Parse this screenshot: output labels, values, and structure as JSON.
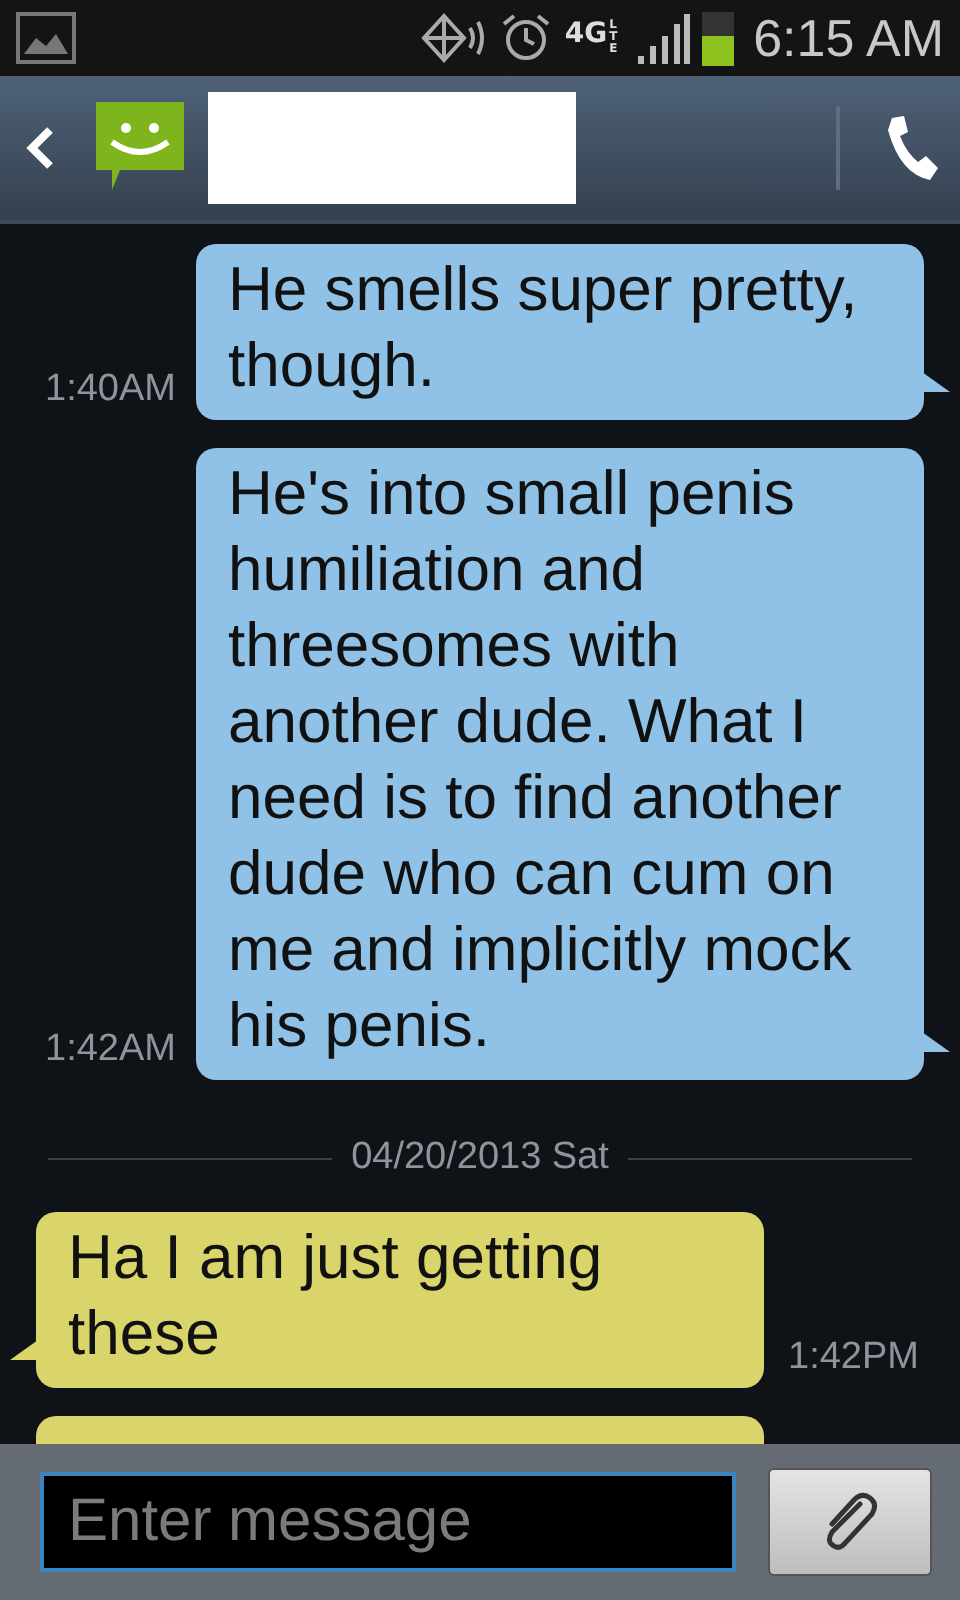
{
  "status_bar": {
    "network": "4G",
    "network_sub": "LTE",
    "time": "6:15 AM"
  },
  "messages": [
    {
      "kind": "sent",
      "text": "He smells super pretty, though.",
      "time": "1:40AM"
    },
    {
      "kind": "sent",
      "text": "He's into small penis humiliation and threesomes with another dude. What I need is to find another dude who can cum on me and implicitly mock his penis.",
      "time": "1:42AM"
    },
    {
      "kind": "date",
      "text": "04/20/2013 Sat"
    },
    {
      "kind": "received",
      "text": "Ha I am just getting these",
      "time": "1:42PM"
    },
    {
      "kind": "received_cut"
    }
  ],
  "composer": {
    "placeholder": "Enter message"
  }
}
